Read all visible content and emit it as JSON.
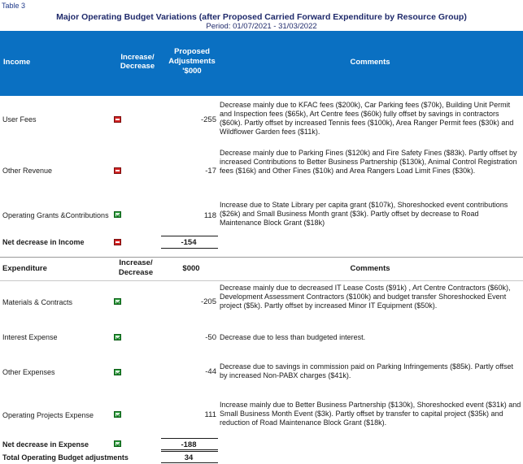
{
  "header": {
    "table_label": "Table 3",
    "title": "Major Operating Budget Variations (after Proposed Carried Forward Expenditure by Resource Group)",
    "period": "Period: 01/07/2021 - 31/03/2022"
  },
  "income": {
    "columns": {
      "name": "Income",
      "direction": "Increase/ Decrease",
      "value": "Proposed Adjustments '$000",
      "comments": "Comments"
    },
    "rows": [
      {
        "label": "User Fees",
        "direction": "down",
        "value": "-255",
        "comment": "Decrease mainly due to KFAC fees ($200k), Car Parking fees ($70k), Building Unit Permit and Inspection fees ($65k), Art Centre fees ($60k) fully offset by savings in contractors ($60k). Partly offset by increased Tennis fees ($100k), Area Ranger Permit fees ($30k) and Wildflower Garden fees ($11k)."
      },
      {
        "label": "Other Revenue",
        "direction": "down",
        "value": "-17",
        "comment": "Decrease mainly due to Parking Fines ($120k) and Fire Safety Fines ($83k). Partly offset by increased Contributions to Better Business Partnership ($130k), Animal Control Registration fees ($16k) and Other Fines ($10k) and Area Rangers Load Limit Fines ($30k)."
      },
      {
        "label": "Operating Grants &Contributions",
        "direction": "up",
        "value": "118",
        "comment": "Increase due to State Library per capita grant ($107k), Shoreshocked event contributions ($26k) and Small Business Month grant ($3k). Partly offset by decrease to Road Maintenance Block Grant ($18k)"
      }
    ],
    "net": {
      "label": "Net decrease in Income",
      "direction": "down",
      "value": "-154"
    }
  },
  "expenditure": {
    "columns": {
      "name": "Expenditure",
      "direction": "Increase/ Decrease",
      "value": "$000",
      "comments": "Comments"
    },
    "rows": [
      {
        "label": "Materials & Contracts",
        "direction": "up",
        "value": "-205",
        "comment": "Decrease mainly due to decreased IT Lease Costs ($91k) , Art Centre Contractors ($60k), Development Assessment Contractors ($100k) and budget transfer Shoreshocked Event project ($5k). Partly offset by increased Minor IT Equipment ($50k)."
      },
      {
        "label": "Interest Expense",
        "direction": "up",
        "value": "-50",
        "comment": "Decrease due to less than budgeted interest."
      },
      {
        "label": "Other Expenses",
        "direction": "up",
        "value": "-44",
        "comment": "Decrease due to savings in commission paid on Parking Infringements ($85k). Partly offset by increased Non-PABX charges ($41k)."
      },
      {
        "label": "Operating Projects Expense",
        "direction": "up",
        "value": "111",
        "comment": "Increase mainly due to Better Business Partnership ($130k), Shoreshocked event ($31k) and Small Business Month Event ($3k). Partly offset by transfer to capital project ($35k) and reduction of Road Maintenance Block Grant ($18k)."
      }
    ],
    "net": {
      "label": "Net decrease in Expense",
      "direction": "up",
      "value": "-188"
    }
  },
  "total": {
    "label": "Total Operating Budget adjustments",
    "value": "34"
  },
  "colors": {
    "header_blue": "#0a70c2",
    "decrease_red": "#d42323",
    "increase_green": "#2aa33a"
  }
}
